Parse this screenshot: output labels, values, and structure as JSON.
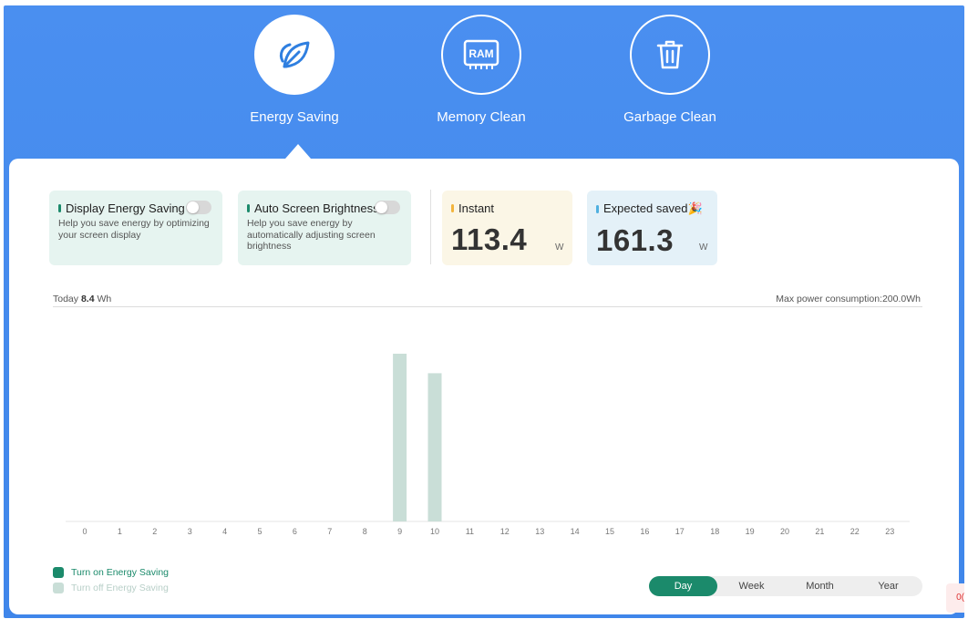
{
  "header": {
    "tabs": [
      {
        "label": "Energy Saving",
        "icon": "leaf-icon",
        "active": true
      },
      {
        "label": "Memory Clean",
        "icon": "ram-icon",
        "active": false
      },
      {
        "label": "Garbage Clean",
        "icon": "trash-icon",
        "active": false
      }
    ],
    "ram_chip_text": "RAM"
  },
  "cards": {
    "display_energy": {
      "title": "Display Energy Saving",
      "desc": "Help you save energy by optimizing your screen display",
      "toggle_on": false
    },
    "auto_brightness": {
      "title": "Auto Screen Brightness",
      "desc": "Help you save energy by automatically adjusting screen brightness",
      "toggle_on": false
    },
    "instant": {
      "title": "Instant",
      "value": "113.4",
      "unit": "W"
    },
    "expected": {
      "title": "Expected saved🎉",
      "value": "161.3",
      "unit": "W"
    }
  },
  "summary": {
    "today_prefix": "Today ",
    "today_value": "8.4",
    "today_unit": " Wh",
    "max_power": "Max power consumption:200.0Wh"
  },
  "chart_data": {
    "type": "bar",
    "categories": [
      "0",
      "1",
      "2",
      "3",
      "4",
      "5",
      "6",
      "7",
      "8",
      "9",
      "10",
      "11",
      "12",
      "13",
      "14",
      "15",
      "16",
      "17",
      "18",
      "19",
      "20",
      "21",
      "22",
      "23"
    ],
    "series": [
      {
        "name": "Turn off Energy Saving",
        "values": [
          0,
          0,
          0,
          0,
          0,
          0,
          0,
          0,
          0,
          4.3,
          3.8,
          0,
          0,
          0,
          0,
          0,
          0,
          0,
          0,
          0,
          0,
          0,
          0,
          0
        ]
      }
    ],
    "ylim": [
      0,
      4.3
    ],
    "grid": false
  },
  "legend": {
    "on_label": "Turn on Energy Saving",
    "off_label": "Turn off Energy Saving"
  },
  "period": {
    "options": [
      "Day",
      "Week",
      "Month",
      "Year"
    ],
    "selected": "Day"
  },
  "edge_tab_text": "0(",
  "colors": {
    "header_blue": "#4a8ff0",
    "accent_green": "#1b8a6b",
    "bar_off": "#c9ded7",
    "legend_on": "#1b8a6b",
    "legend_off": "#c9ded7",
    "instant_mark": "#f2b43c",
    "expected_mark": "#4fb0e0"
  }
}
